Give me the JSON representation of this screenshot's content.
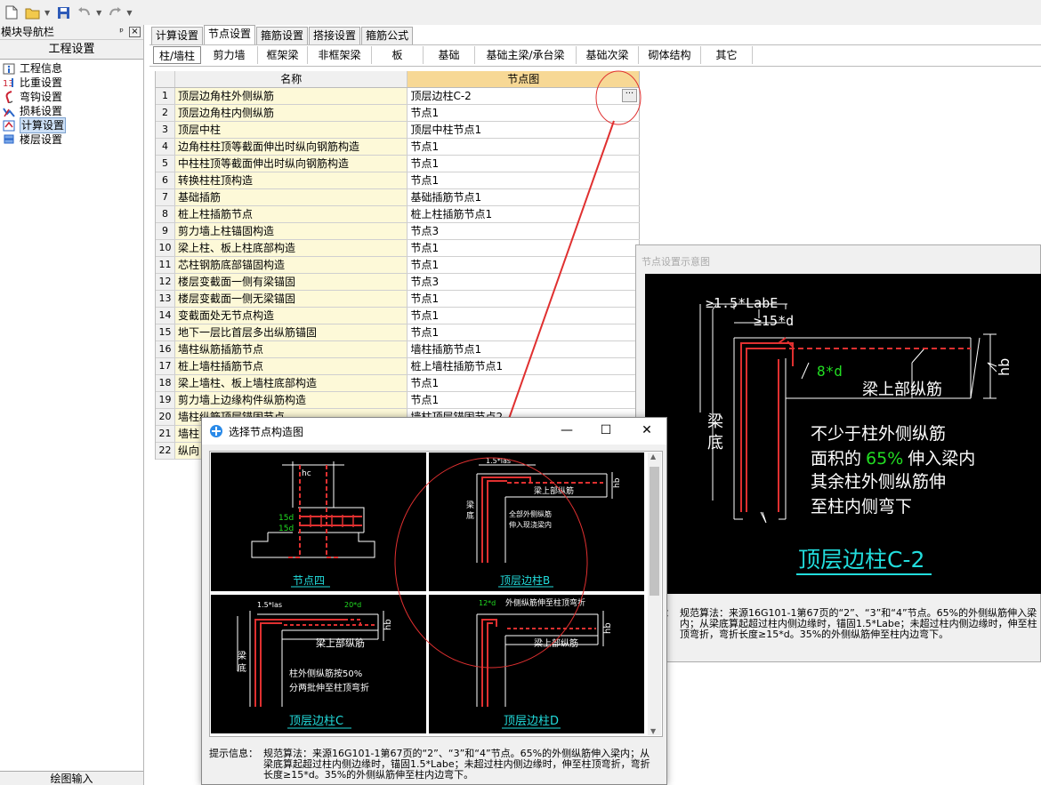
{
  "nav": {
    "title": "模块导航栏",
    "pin": "ᵖ",
    "close": "×",
    "header": "工程设置",
    "items": [
      {
        "label": "工程信息",
        "icon": "info-icon",
        "selected": false
      },
      {
        "label": "比重设置",
        "icon": "weight-icon",
        "selected": false
      },
      {
        "label": "弯钩设置",
        "icon": "hook-icon",
        "selected": false
      },
      {
        "label": "损耗设置",
        "icon": "loss-icon",
        "selected": false
      },
      {
        "label": "计算设置",
        "icon": "calc-icon",
        "selected": true
      },
      {
        "label": "楼层设置",
        "icon": "floor-icon",
        "selected": false
      }
    ],
    "bottom": "绘图输入"
  },
  "tabs1": [
    "计算设置",
    "节点设置",
    "箍筋设置",
    "搭接设置",
    "箍筋公式"
  ],
  "tabs1_active": 1,
  "tabs2": [
    "柱/墙柱",
    "剪力墙",
    "框架梁",
    "非框架梁",
    "板",
    "基础",
    "基础主梁/承台梁",
    "基础次梁",
    "砌体结构",
    "其它"
  ],
  "tabs2_active": 0,
  "grid": {
    "col_name": "名称",
    "col_node": "节点图",
    "ellipsis": "···",
    "rows": [
      {
        "n": "1",
        "name": "顶层边角柱外侧纵筋",
        "node": "顶层边柱C-2"
      },
      {
        "n": "2",
        "name": "顶层边角柱内侧纵筋",
        "node": "节点1"
      },
      {
        "n": "3",
        "name": "顶层中柱",
        "node": "顶层中柱节点1"
      },
      {
        "n": "4",
        "name": "边角柱柱顶等截面伸出时纵向钢筋构造",
        "node": "节点1"
      },
      {
        "n": "5",
        "name": "中柱柱顶等截面伸出时纵向钢筋构造",
        "node": "节点1"
      },
      {
        "n": "6",
        "name": "转换柱柱顶构造",
        "node": "节点1"
      },
      {
        "n": "7",
        "name": "基础插筋",
        "node": "基础插筋节点1"
      },
      {
        "n": "8",
        "name": "桩上柱插筋节点",
        "node": "桩上柱插筋节点1"
      },
      {
        "n": "9",
        "name": "剪力墙上柱锚固构造",
        "node": "节点3"
      },
      {
        "n": "10",
        "name": "梁上柱、板上柱底部构造",
        "node": "节点1"
      },
      {
        "n": "11",
        "name": "芯柱钢筋底部锚固构造",
        "node": "节点1"
      },
      {
        "n": "12",
        "name": "楼层变截面一侧有梁锚固",
        "node": "节点3"
      },
      {
        "n": "13",
        "name": "楼层变截面一侧无梁锚固",
        "node": "节点1"
      },
      {
        "n": "14",
        "name": "变截面处无节点构造",
        "node": "节点1"
      },
      {
        "n": "15",
        "name": "地下一层比首层多出纵筋锚固",
        "node": "节点1"
      },
      {
        "n": "16",
        "name": "墙柱纵筋插筋节点",
        "node": "墙柱插筋节点1"
      },
      {
        "n": "17",
        "name": "桩上墙柱插筋节点",
        "node": "桩上墙柱插筋节点1"
      },
      {
        "n": "18",
        "name": "梁上墙柱、板上墙柱底部构造",
        "node": "节点1"
      },
      {
        "n": "19",
        "name": "剪力墙上边缘构件纵筋构造",
        "node": "节点1"
      },
      {
        "n": "20",
        "name": "墙柱纵筋顶层锚固节点",
        "node": "墙柱顶层锚固节点2"
      },
      {
        "n": "21",
        "name": "墙柱",
        "node": ""
      },
      {
        "n": "22",
        "name": "纵向",
        "node": ""
      }
    ]
  },
  "preview": {
    "title": "节点设置示意图",
    "label_labe": "≥1.5*LabE",
    "label_15d": "≥15*d",
    "label_8d": "8*d",
    "label_hb": "hb",
    "label_beam_top": "梁上部纵筋",
    "label_beam_bottom_1": "梁",
    "label_beam_bottom_2": "底",
    "desc_line1": "不少于柱外侧纵筋",
    "desc_line2_a": "面积的",
    "desc_line2_b": "65%",
    "desc_line2_c": "伸入梁内",
    "desc_line3": "其余柱外侧纵筋伸",
    "desc_line4": "至柱内侧弯下",
    "caption": "顶层边柱C-2",
    "hint_label": "信息：",
    "hint_text": "规范算法：来源16G101-1第67页的“2”、“3”和“4”节点。65%的外侧纵筋伸入梁内；从梁底算起超过柱内侧边缘时，锚固1.5*Labe；未超过柱内侧边缘时，伸至柱顶弯折，弯折长度≥15*d。35%的外侧纵筋伸至柱内边弯下。"
  },
  "dialog": {
    "title": "选择节点构造图",
    "minimize": "—",
    "maximize": "☐",
    "close": "✕",
    "thumbs": [
      {
        "caption": "节点四",
        "label_a": "hc",
        "label_b": "15d",
        "label_c": "15d"
      },
      {
        "caption": "顶层边柱B",
        "label_a": "1.5*las",
        "label_b": "梁上部纵筋",
        "label_c": "全部外侧纵筋",
        "label_d": "伸入现浇梁内",
        "label_e": "梁",
        "label_f": "底",
        "label_g": "hb"
      },
      {
        "caption": "顶层边柱C",
        "label_a": "1.5*las",
        "label_b": "20*d",
        "label_c": "梁上部纵筋",
        "label_d": "柱外侧纵筋按50%",
        "label_e": "分两批伸至柱顶弯折",
        "label_f": "梁",
        "label_g": "底",
        "label_h": "hb"
      },
      {
        "caption": "顶层边柱D",
        "label_a": "12*d",
        "label_b": "外侧纵筋伸至柱顶弯折",
        "label_c": "梁上部纵筋",
        "label_d": "hb"
      }
    ],
    "hint_label": "提示信息：",
    "hint_text": "规范算法：来源16G101-1第67页的“2”、“3”和“4”节点。65%的外侧纵筋伸入梁内；从梁底算起超过柱内侧边缘时，锚固1.5*Labe；未超过柱内侧边缘时，伸至柱顶弯折，弯折长度≥15*d。35%的外侧纵筋伸至柱内边弯下。"
  },
  "colors": {
    "accent_red": "#e03030",
    "cad_white": "#ffffff",
    "cad_green": "#22dd22",
    "cad_cyan": "#22dddd",
    "header_yellow": "#f7d895",
    "name_cell": "#fdf9d8"
  }
}
